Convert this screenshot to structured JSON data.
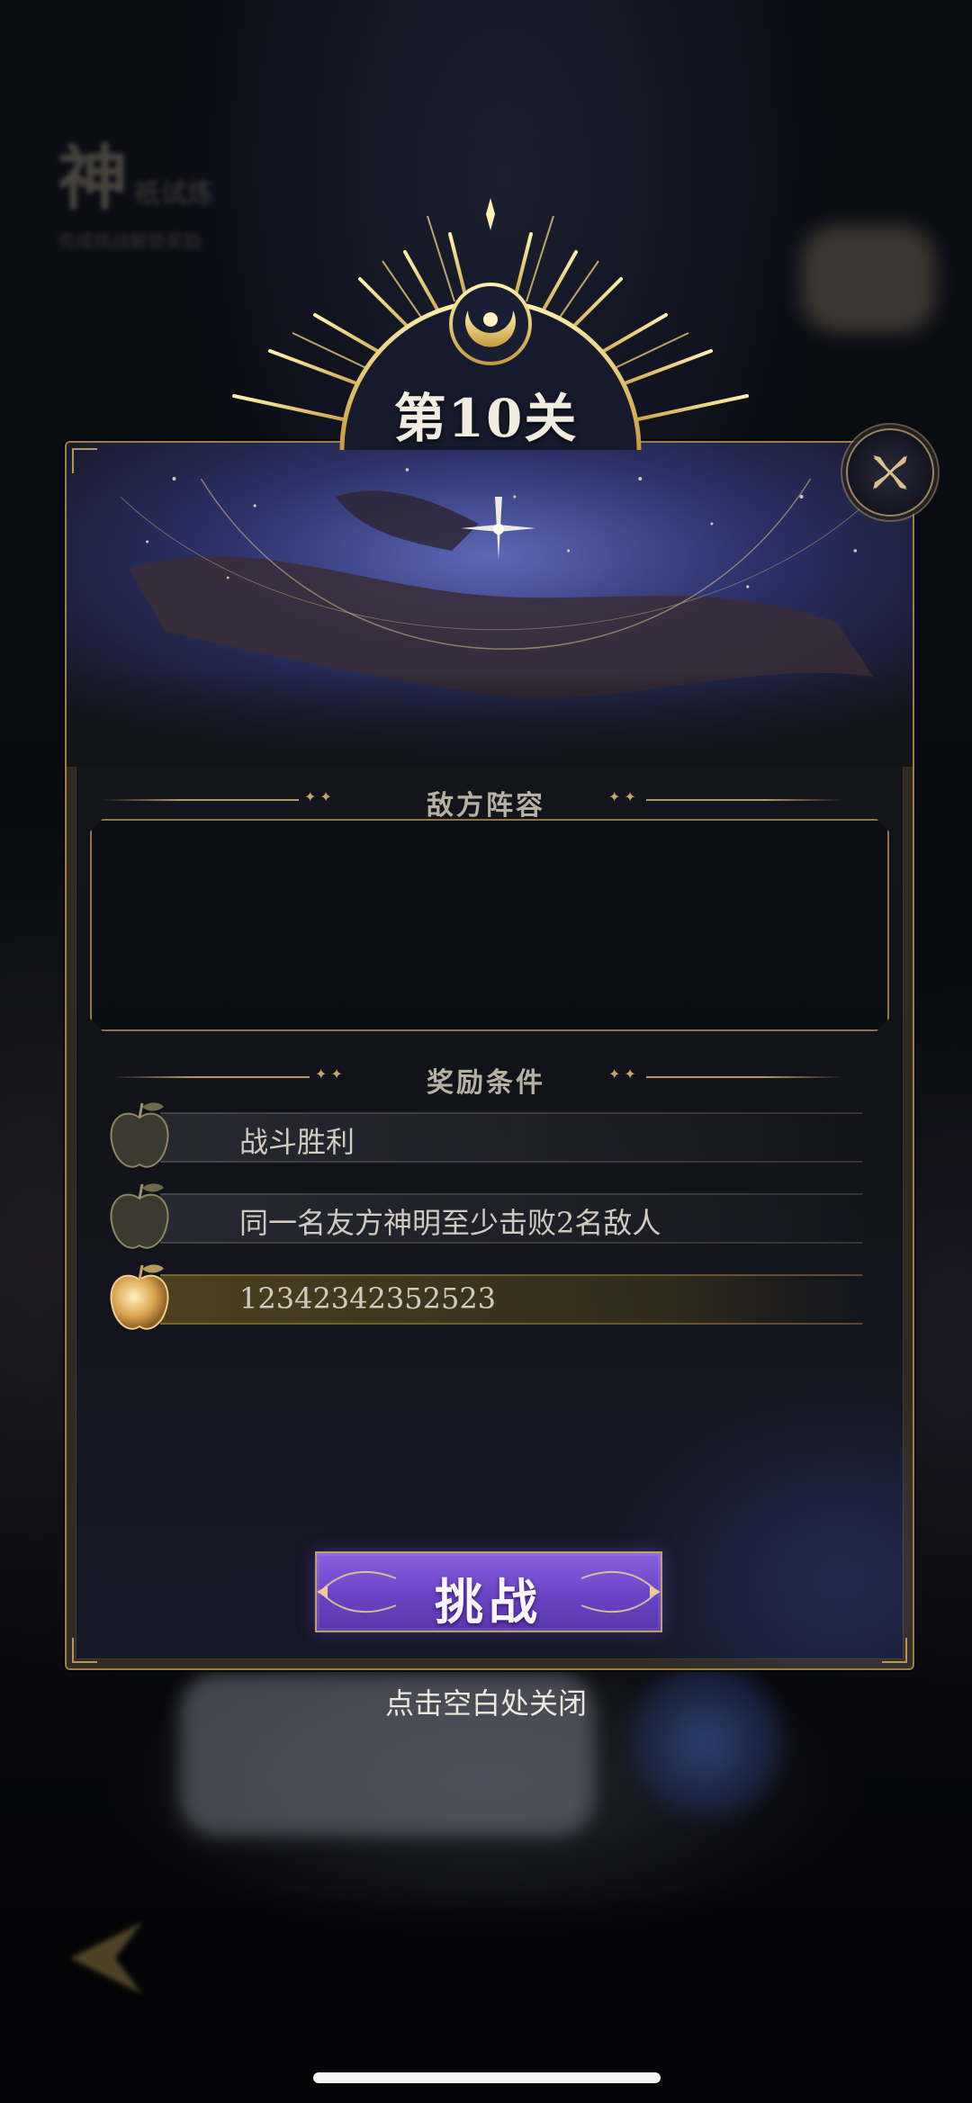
{
  "level": {
    "title": "第10关"
  },
  "background": {
    "title_big": "神",
    "title_small": "祇试炼",
    "subtitle": "完成挑战解锁奖励"
  },
  "enemy_section": {
    "title": "敌方阵容"
  },
  "reward_section": {
    "title": "奖励条件",
    "items": [
      {
        "text": "战斗胜利",
        "status": "incomplete",
        "icon": "apple-icon-dark"
      },
      {
        "text": "同一名友方神明至少击败2名敌人",
        "status": "incomplete",
        "icon": "apple-icon-dark"
      },
      {
        "text": "12342342352523",
        "status": "complete",
        "icon": "apple-icon-gold"
      }
    ]
  },
  "buttons": {
    "challenge": "挑战"
  },
  "close_hint": "点击空白处关闭",
  "colors": {
    "accent_gold": "#b59663",
    "button_purple": "#6a43c4",
    "panel_bg": "#121319"
  }
}
